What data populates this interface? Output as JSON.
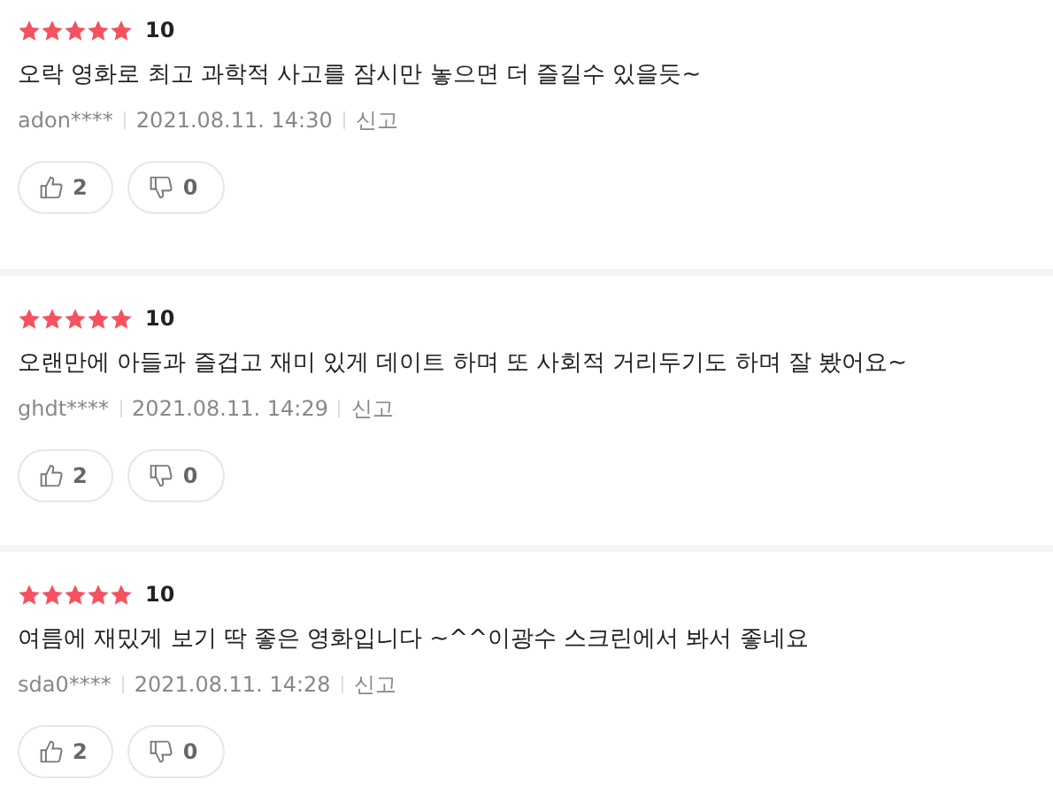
{
  "reviews": [
    {
      "stars": 5,
      "score": "10",
      "text": "오락 영화로 최고 과학적 사고를 잠시만 놓으면 더 즐길수 있을듯~",
      "user": "adon****",
      "date": "2021.08.11. 14:30",
      "report": "신고",
      "likes": "2",
      "dislikes": "0"
    },
    {
      "stars": 5,
      "score": "10",
      "text": "오랜만에 아들과 즐겁고 재미 있게 데이트 하며 또 사회적 거리두기도 하며 잘 봤어요~",
      "user": "ghdt****",
      "date": "2021.08.11. 14:29",
      "report": "신고",
      "likes": "2",
      "dislikes": "0"
    },
    {
      "stars": 5,
      "score": "10",
      "text": "여름에 재밌게 보기 딱 좋은 영화입니다 ~^^이광수 스크린에서 봐서 좋네요",
      "user": "sda0****",
      "date": "2021.08.11. 14:28",
      "report": "신고",
      "likes": "2",
      "dislikes": "0"
    }
  ]
}
